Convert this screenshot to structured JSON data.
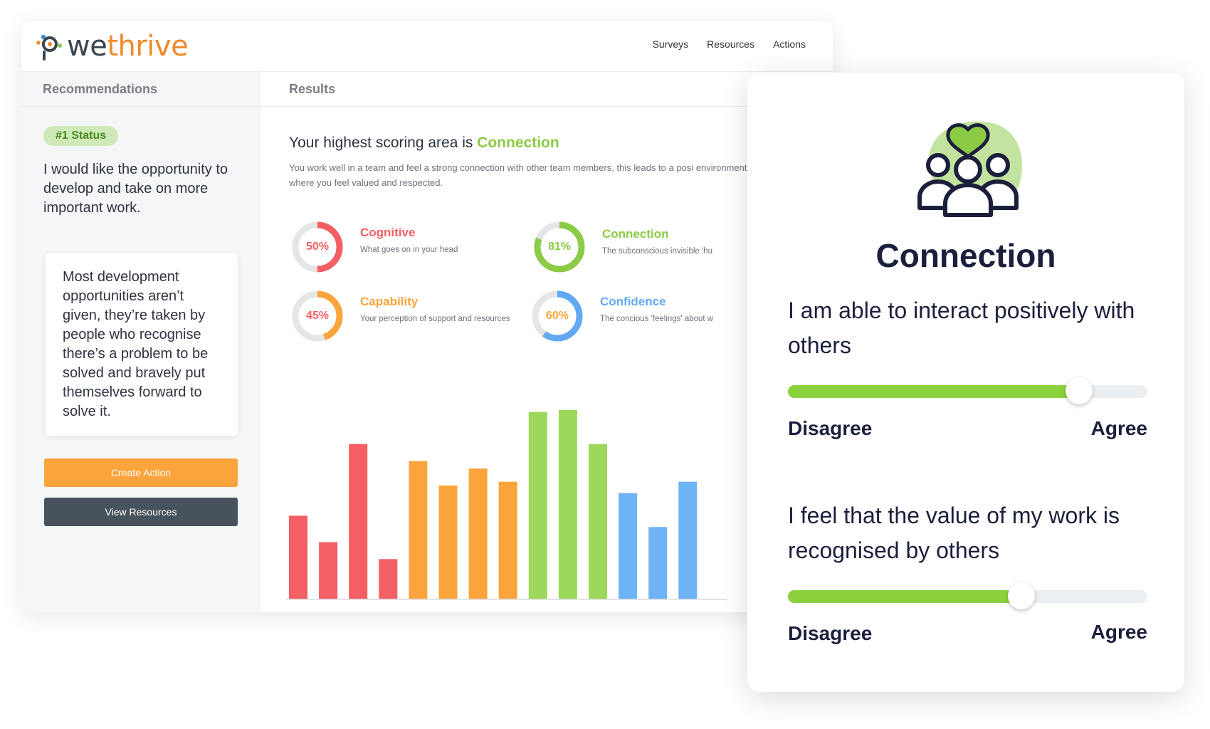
{
  "brand": {
    "logo_part1": "we",
    "logo_part2": "thrive",
    "colors": {
      "orange": "#f08a2a",
      "green": "#8bcb45",
      "dark": "#3a4550"
    }
  },
  "nav": {
    "items": [
      "Surveys",
      "Resources",
      "Actions"
    ]
  },
  "left_panel": {
    "header": "Recommendations",
    "badge": "#1 Status",
    "status_text": "I would like the opportunity to develop and take on more important work.",
    "quote": "Most development opportunities aren’t given, they’re taken by people who recognise there’s a problem to be solved and bravely put themselves forward to solve it.",
    "create_action_label": "Create Action",
    "view_resources_label": "View Resources"
  },
  "results": {
    "header": "Results",
    "highest_prefix": "Your highest scoring area is ",
    "highest_area": "Connection",
    "highest_desc": "You work well in a team and feel a strong connection with other team members, this leads to a posi environment where you feel valued and respected.",
    "metrics": [
      {
        "name": "Cognitive",
        "pct_label": "50%",
        "value": 50,
        "desc": "What goes on in your head",
        "color": "#f45f64"
      },
      {
        "name": "Connection",
        "pct_label": "81%",
        "value": 81,
        "desc": "The subconscious invisible 'hu",
        "color": "#8bcb45"
      },
      {
        "name": "Capability",
        "pct_label": "45%",
        "value": 45,
        "desc": "Your perception of support and resources",
        "color": "#fca43c"
      },
      {
        "name": "Confidence",
        "pct_label": "60%",
        "value": 60,
        "desc": "The concious 'feelings' about w",
        "color": "#62a9f2"
      }
    ]
  },
  "chart_data": {
    "type": "bar",
    "ylim": [
      0,
      100
    ],
    "values": [
      44,
      30,
      82,
      21,
      73,
      60,
      69,
      62,
      99,
      100,
      82,
      56,
      38,
      62
    ],
    "colors": [
      "#f45f64",
      "#f45f64",
      "#f45f64",
      "#f45f64",
      "#fca43c",
      "#fca43c",
      "#fca43c",
      "#fca43c",
      "#9bd85c",
      "#9bd85c",
      "#9bd85c",
      "#6db3f5",
      "#6db3f5",
      "#6db3f5"
    ]
  },
  "overlay": {
    "title": "Connection",
    "illustration_icon": "team-heart-icon",
    "q1": {
      "text": "I am able to interact positively with others",
      "value": 0.81,
      "min_label": "Disagree",
      "max_label": "Agree"
    },
    "q2": {
      "text": "I feel that the value of my work is recognised by others",
      "value": 0.65,
      "min_label": "Disagree",
      "max_label": "Agree"
    }
  }
}
